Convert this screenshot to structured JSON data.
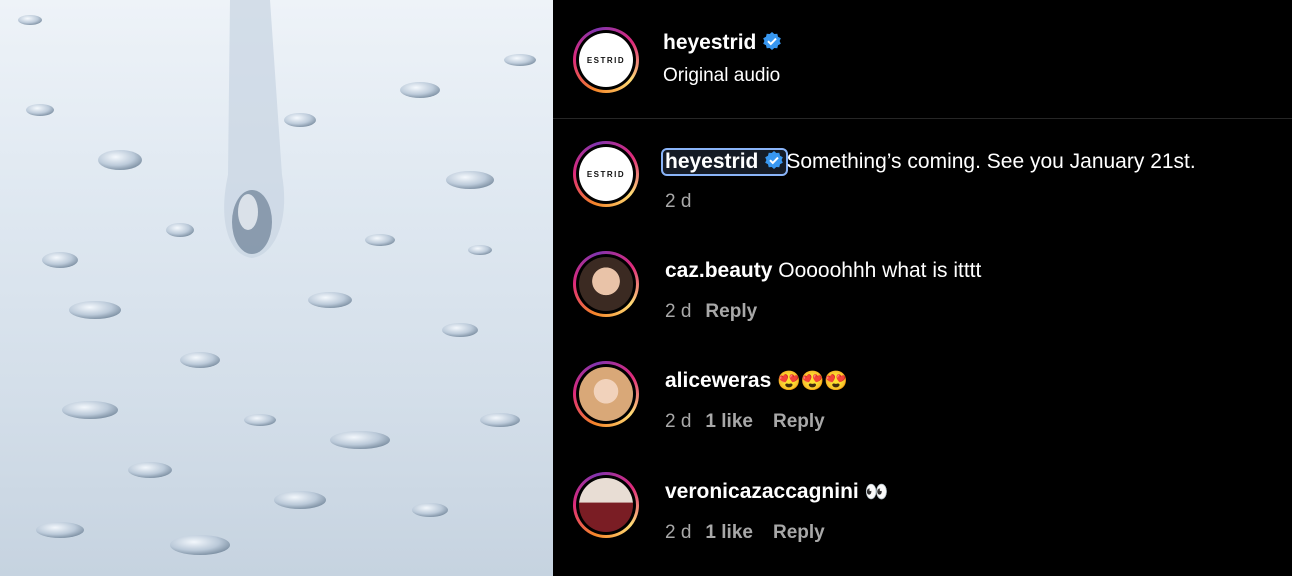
{
  "header": {
    "username": "heyestrid",
    "subtitle": "Original audio",
    "avatar_text": "ESTRID"
  },
  "caption": {
    "username": "heyestrid",
    "text": "Something’s coming. See you January 21st.",
    "time": "2 d"
  },
  "comments": [
    {
      "username": "caz.beauty",
      "text": "Ooooohhh what is itttt",
      "time": "2 d",
      "likes": "",
      "reply": "Reply"
    },
    {
      "username": "aliceweras",
      "text": "😍😍😍",
      "time": "2 d",
      "likes": "1 like",
      "reply": "Reply"
    },
    {
      "username": "veronicazaccagnini",
      "text": "👀",
      "time": "2 d",
      "likes": "1 like",
      "reply": "Reply"
    }
  ],
  "colors": {
    "verified": "#3897f0",
    "meta": "#a8a8a8",
    "background": "#000000"
  },
  "icons": {
    "verified": "verified-badge-icon"
  }
}
